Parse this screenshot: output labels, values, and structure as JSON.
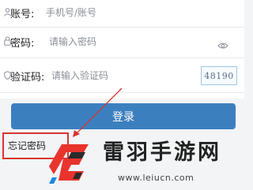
{
  "form": {
    "account": {
      "label": "账号:",
      "placeholder": "手机号/账号"
    },
    "password": {
      "label": "密码:",
      "placeholder": "请输入密码"
    },
    "captcha": {
      "label": "验证码:",
      "placeholder": "请输入验证码",
      "image_text": "48190"
    }
  },
  "login_button": {
    "label": "登录"
  },
  "forgot_password": {
    "label": "忘记密码"
  },
  "watermark": {
    "title": "雷羽手游网",
    "url": "www.leiucn.com"
  },
  "colors": {
    "primary": "#3c7fbf",
    "annotation": "#d8352f"
  }
}
